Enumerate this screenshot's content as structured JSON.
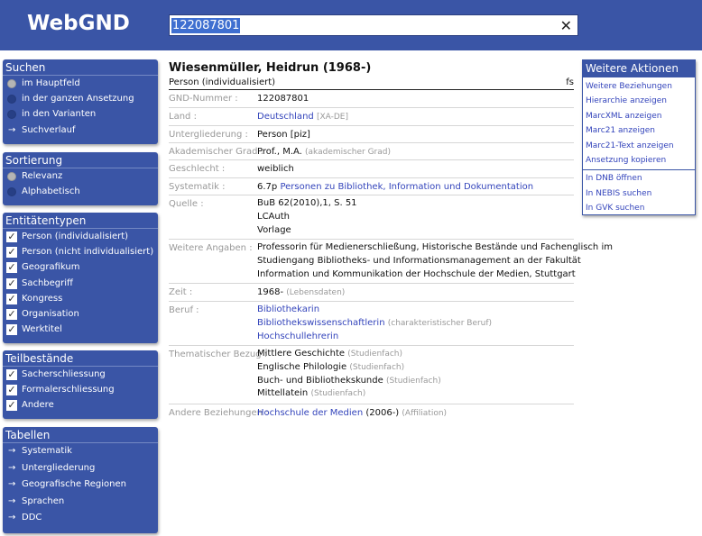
{
  "header": {
    "logo": "WebGND",
    "search_value": "122087801"
  },
  "colors": {
    "brand": "#3a55a6",
    "link": "#3344bb"
  },
  "sidebar": {
    "suchen": {
      "title": "Suchen",
      "items": [
        {
          "label": "im Hauptfeld",
          "checked": true
        },
        {
          "label": "in der ganzen Ansetzung",
          "checked": false
        },
        {
          "label": "in den Varianten",
          "checked": false
        }
      ],
      "history": "Suchverlauf"
    },
    "sortierung": {
      "title": "Sortierung",
      "items": [
        {
          "label": "Relevanz",
          "checked": true
        },
        {
          "label": "Alphabetisch",
          "checked": false
        }
      ]
    },
    "entitaetentypen": {
      "title": "Entitätentypen",
      "items": [
        "Person (individualisiert)",
        "Person (nicht individualisiert)",
        "Geografikum",
        "Sachbegriff",
        "Kongress",
        "Organisation",
        "Werktitel"
      ]
    },
    "teilbestaende": {
      "title": "Teilbestände",
      "items": [
        "Sacherschliessung",
        "Formalerschliessung",
        "Andere"
      ]
    },
    "tabellen": {
      "title": "Tabellen",
      "items": [
        "Systematik",
        "Untergliederung",
        "Geografische Regionen",
        "Sprachen",
        "DDC"
      ]
    }
  },
  "record": {
    "title": "Wiesenmüller, Heidrun (1968-)",
    "type": "Person (individualisiert)",
    "code": "fs",
    "gnd_label": "GND-Nummer :",
    "gnd_value": "122087801",
    "land_label": "Land :",
    "land_link": "Deutschland",
    "land_code": "[XA-DE]",
    "unter_label": "Untergliederung :",
    "unter_link": "Person [piz]",
    "grad_label": "Akademischer Grad :",
    "grad_value": "Prof., M.A.",
    "grad_note": "(akademischer Grad)",
    "geschlecht_label": "Geschlecht :",
    "geschlecht_value": "weiblich",
    "syst_label": "Systematik :",
    "syst_code": "6.7p",
    "syst_link": "Personen zu Bibliothek, Information und Dokumentation",
    "quelle_label": "Quelle :",
    "quelle_lines": [
      "BuB 62(2010),1, S. 51",
      "LCAuth",
      "Vorlage"
    ],
    "weitere_label": "Weitere Angaben :",
    "weitere_lines": [
      "Professorin für Medienerschließung, Historische Bestände und Fachenglisch im",
      "Studiengang Bibliotheks- und Informationsmanagement an der Fakultät",
      "Information und Kommunikation der Hochschule der Medien, Stuttgart"
    ],
    "zeit_label": "Zeit :",
    "zeit_value": "1968-",
    "zeit_note": "(Lebensdaten)",
    "beruf_label": "Beruf :",
    "beruf_1": "Bibliothekarin",
    "beruf_2": "Bibliothekswissenschaftlerin",
    "beruf_2_note": "(charakteristischer Beruf)",
    "beruf_3": "Hochschullehrerin",
    "thema_label": "Thematischer Bezug :",
    "thema": [
      {
        "name": "Mittlere Geschichte",
        "note": "(Studienfach)"
      },
      {
        "name": "Englische Philologie",
        "note": "(Studienfach)"
      },
      {
        "name": "Buch- und Bibliothekskunde",
        "note": "(Studienfach)"
      },
      {
        "name": "Mittellatein",
        "note": "(Studienfach)"
      }
    ],
    "andere_label": "Andere Beziehungen :",
    "andere_link": "Hochschule der Medien",
    "andere_years": "(2006-)",
    "andere_note": "(Affiliation)"
  },
  "actions": {
    "title": "Weitere Aktionen",
    "items": [
      "Weitere Beziehungen",
      "Hierarchie anzeigen",
      "MarcXML anzeigen",
      "Marc21 anzeigen",
      "Marc21-Text anzeigen",
      "Ansetzung kopieren"
    ],
    "external": [
      "In DNB öffnen",
      "In NEBIS suchen",
      "In GVK suchen"
    ]
  }
}
